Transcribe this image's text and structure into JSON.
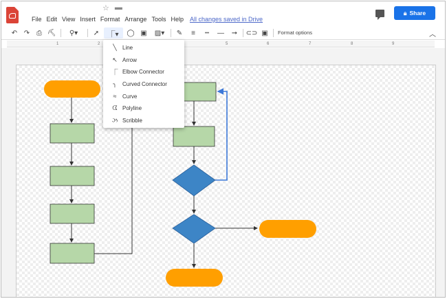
{
  "menu": {
    "items": [
      "File",
      "Edit",
      "View",
      "Insert",
      "Format",
      "Arrange",
      "Tools",
      "Help"
    ],
    "save_status": "All changes saved in Drive"
  },
  "share_button": {
    "label": "Share"
  },
  "toolbar": {
    "format_options": "Format options"
  },
  "ruler": {
    "ticks": [
      "1",
      "2",
      "5",
      "6",
      "7",
      "8",
      "9"
    ]
  },
  "line_menu": {
    "items": [
      {
        "label": "Line",
        "icon": "line-icon"
      },
      {
        "label": "Arrow",
        "icon": "arrow-icon"
      },
      {
        "label": "Elbow Connector",
        "icon": "elbow-connector-icon"
      },
      {
        "label": "Curved Connector",
        "icon": "curved-connector-icon"
      },
      {
        "label": "Curve",
        "icon": "curve-icon"
      },
      {
        "label": "Polyline",
        "icon": "polyline-icon"
      },
      {
        "label": "Scribble",
        "icon": "scribble-icon"
      }
    ]
  },
  "colors": {
    "terminator": "#ff9f00",
    "process": "#b6d7a8",
    "decision": "#3d85c6",
    "selected_connector": "#3c78d8",
    "accent": "#1a73e8"
  }
}
